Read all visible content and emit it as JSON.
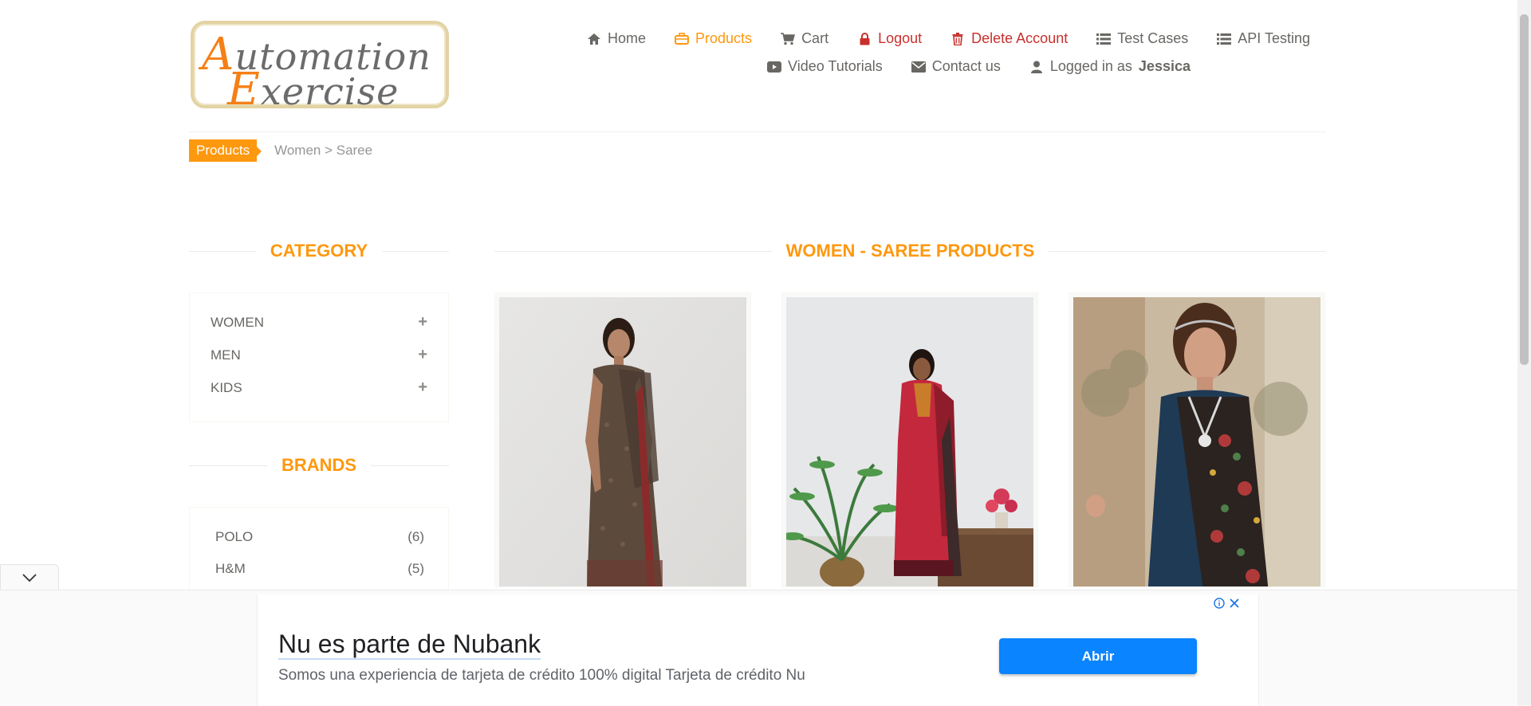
{
  "header": {
    "logo_text": "Automation Exercise",
    "nav_row1": [
      {
        "label": "Home",
        "icon": "home-icon"
      },
      {
        "label": "Products",
        "icon": "briefcase-icon",
        "active": true
      },
      {
        "label": "Cart",
        "icon": "cart-icon"
      },
      {
        "label": "Logout",
        "icon": "lock-icon"
      },
      {
        "label": "Delete Account",
        "icon": "trash-icon"
      },
      {
        "label": "Test Cases",
        "icon": "list-icon"
      },
      {
        "label": "API Testing",
        "icon": "list-icon"
      }
    ],
    "nav_row2": [
      {
        "label": "Video Tutorials",
        "icon": "youtube-play-icon"
      },
      {
        "label": "Contact us",
        "icon": "envelope-icon"
      },
      {
        "label": "Logged in as",
        "icon": "user-icon",
        "user": "Jessica"
      }
    ]
  },
  "breadcrumb": {
    "tag": "Products",
    "path": "Women > Saree"
  },
  "sidebar": {
    "category_title": "CATEGORY",
    "categories": [
      "WOMEN",
      "MEN",
      "KIDS"
    ],
    "brands_title": "BRANDS",
    "brands": [
      {
        "name": "POLO",
        "count": "(6)"
      },
      {
        "name": "H&M",
        "count": "(5)"
      }
    ]
  },
  "main": {
    "title": "WOMEN - SAREE PRODUCTS",
    "products": [
      {
        "image": "saree-brown"
      },
      {
        "image": "saree-red"
      },
      {
        "image": "saree-blue-floral"
      }
    ]
  },
  "ad": {
    "title": "Nu es parte de Nubank",
    "description": "Somos una experiencia de tarjeta de crédito 100% digital Tarjeta de crédito Nu",
    "button": "Abrir"
  },
  "colors": {
    "accent": "#fe980f",
    "danger": "#c9302c",
    "ad_button": "#0a84ff"
  }
}
